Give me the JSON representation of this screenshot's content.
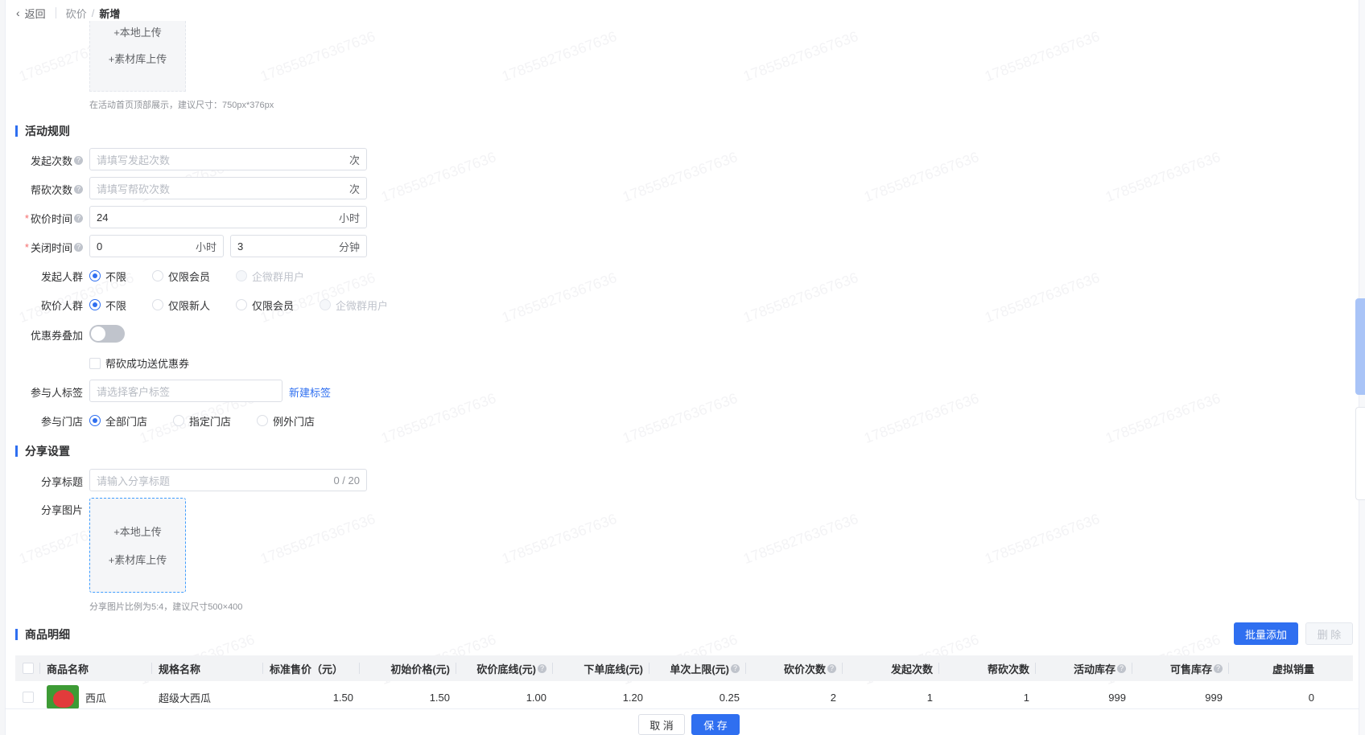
{
  "header": {
    "back_label": "返回",
    "breadcrumb_parent": "砍价",
    "breadcrumb_separator": "/",
    "breadcrumb_current": "新增"
  },
  "top_upload": {
    "local_upload": "+本地上传",
    "library_upload": "+素材库上传",
    "hint": "在活动首页顶部展示，建议尺寸：750px*376px"
  },
  "rules_section": {
    "title": "活动规则",
    "launch_count": {
      "label": "发起次数",
      "placeholder": "请填写发起次数",
      "suffix": "次"
    },
    "help_count": {
      "label": "帮砍次数",
      "placeholder": "请填写帮砍次数",
      "suffix": "次"
    },
    "bargain_time": {
      "label": "砍价时间",
      "value": "24",
      "suffix": "小时"
    },
    "close_time": {
      "label": "关闭时间",
      "hours_value": "0",
      "hours_suffix": "小时",
      "minutes_value": "3",
      "minutes_suffix": "分钟"
    },
    "launch_crowd": {
      "label": "发起人群",
      "options": [
        "不限",
        "仅限会员",
        "企微群用户"
      ],
      "selected": "不限"
    },
    "bargain_crowd": {
      "label": "砍价人群",
      "options": [
        "不限",
        "仅限新人",
        "仅限会员",
        "企微群用户"
      ],
      "selected": "不限"
    },
    "coupon_stack": {
      "label": "优惠券叠加",
      "enabled": false
    },
    "help_coupon_checkbox": "帮砍成功送优惠券",
    "participant_tag": {
      "label": "参与人标签",
      "placeholder": "请选择客户标签",
      "new_tag_link": "新建标签"
    },
    "stores": {
      "label": "参与门店",
      "options": [
        "全部门店",
        "指定门店",
        "例外门店"
      ],
      "selected": "全部门店"
    }
  },
  "share_section": {
    "title": "分享设置",
    "share_title": {
      "label": "分享标题",
      "placeholder": "请输入分享标题",
      "counter": "0 / 20"
    },
    "share_image": {
      "label": "分享图片",
      "local_upload": "+本地上传",
      "library_upload": "+素材库上传",
      "hint": "分享图片比例为5:4，建议尺寸500×400"
    }
  },
  "goods_section": {
    "title": "商品明细",
    "batch_add_button": "批量添加",
    "delete_button": "删 除",
    "columns": [
      "商品名称",
      "规格名称",
      "标准售价（元）",
      "初始价格(元)",
      "砍价底线(元)",
      "下单底线(元)",
      "单次上限(元)",
      "砍价次数",
      "发起次数",
      "帮砍次数",
      "活动库存",
      "可售库存",
      "虚拟销量"
    ],
    "rows": [
      {
        "name": "西瓜",
        "spec": "超级大西瓜",
        "standard_price": "1.50",
        "initial_price": "1.50",
        "floor_price": "1.00",
        "order_floor": "1.20",
        "single_max": "0.25",
        "bargain_times": "2",
        "launch_times": "1",
        "help_times": "1",
        "activity_stock": "999",
        "sale_stock": "999",
        "virtual_sales": "0"
      }
    ]
  },
  "footer": {
    "cancel_button": "取 消",
    "save_button": "保 存"
  },
  "watermark_text": "17855827636763​6",
  "colors": {
    "primary": "#2f6ff0",
    "required": "#f56c6c",
    "header_bg": "#f2f3f5"
  }
}
